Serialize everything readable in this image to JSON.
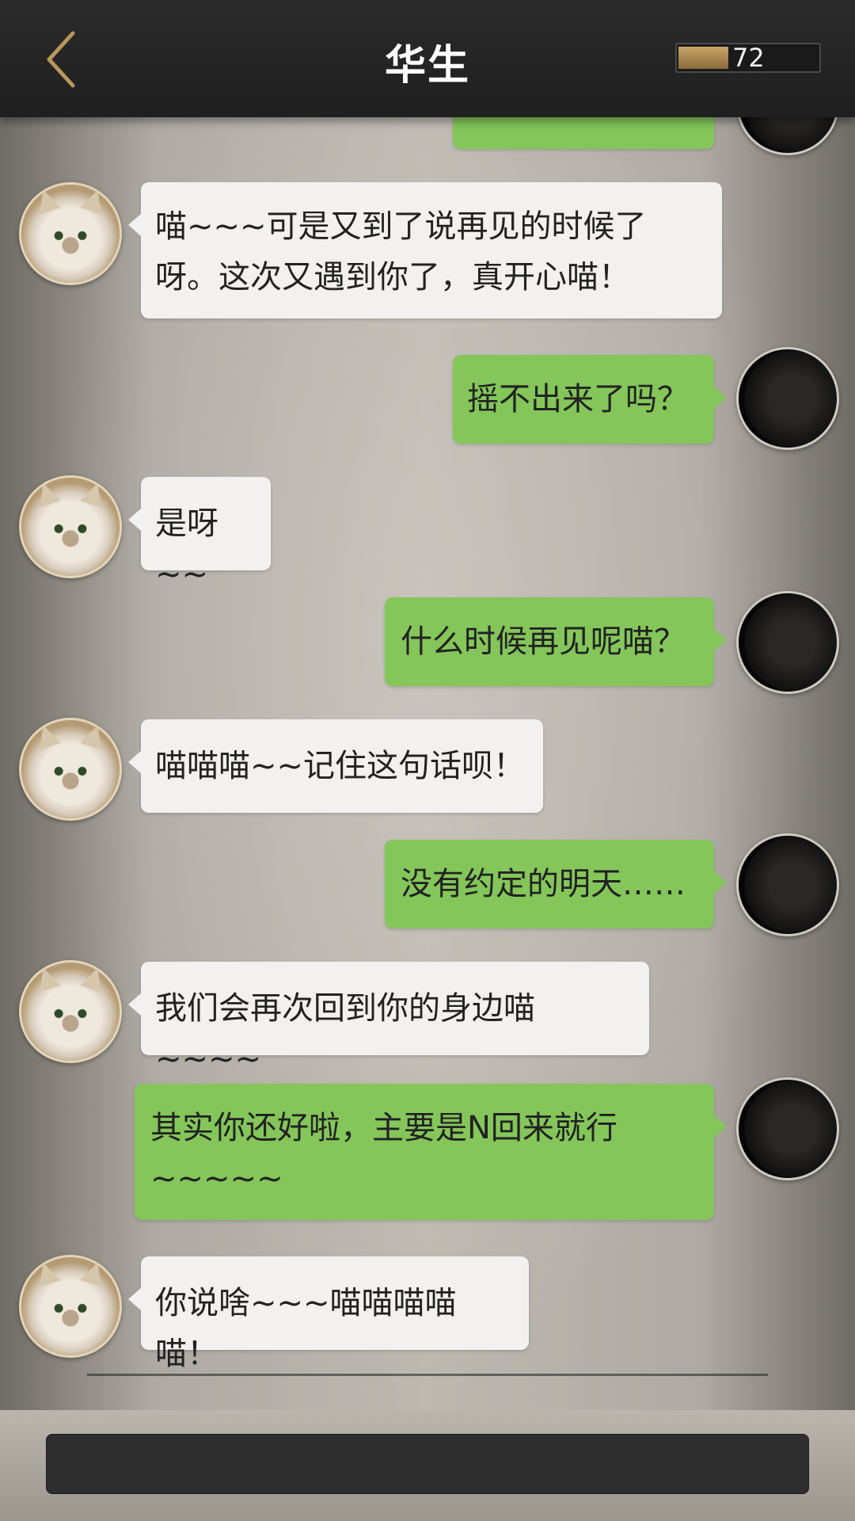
{
  "header": {
    "title": "华生",
    "progress_value": 72,
    "progress_fraction": 0.35
  },
  "messages": [
    {
      "side": "right",
      "text": ""
    },
    {
      "side": "left",
      "text": "喵~~~可是又到了说再见的时候了呀。这次又遇到你了，真开心喵！"
    },
    {
      "side": "right",
      "text": "摇不出来了吗？"
    },
    {
      "side": "left",
      "text": "是呀~~"
    },
    {
      "side": "right",
      "text": "什么时候再见呢喵？"
    },
    {
      "side": "left",
      "text": "喵喵喵~~记住这句话呗！"
    },
    {
      "side": "right",
      "text": "没有约定的明天……"
    },
    {
      "side": "left",
      "text": "我们会再次回到你的身边喵~~~~"
    },
    {
      "side": "right",
      "text": "其实你还好啦，主要是N回来就行~~~~~"
    },
    {
      "side": "left",
      "text": "你说啥~~~喵喵喵喵喵！"
    }
  ],
  "input": {
    "value": ""
  },
  "colors": {
    "header_bg": "#222222",
    "left_bubble": "#f2f1ef",
    "right_bubble": "#84c65a",
    "progress_fill": "#b08b51"
  },
  "icons": {
    "back": "chevron-left-icon"
  }
}
